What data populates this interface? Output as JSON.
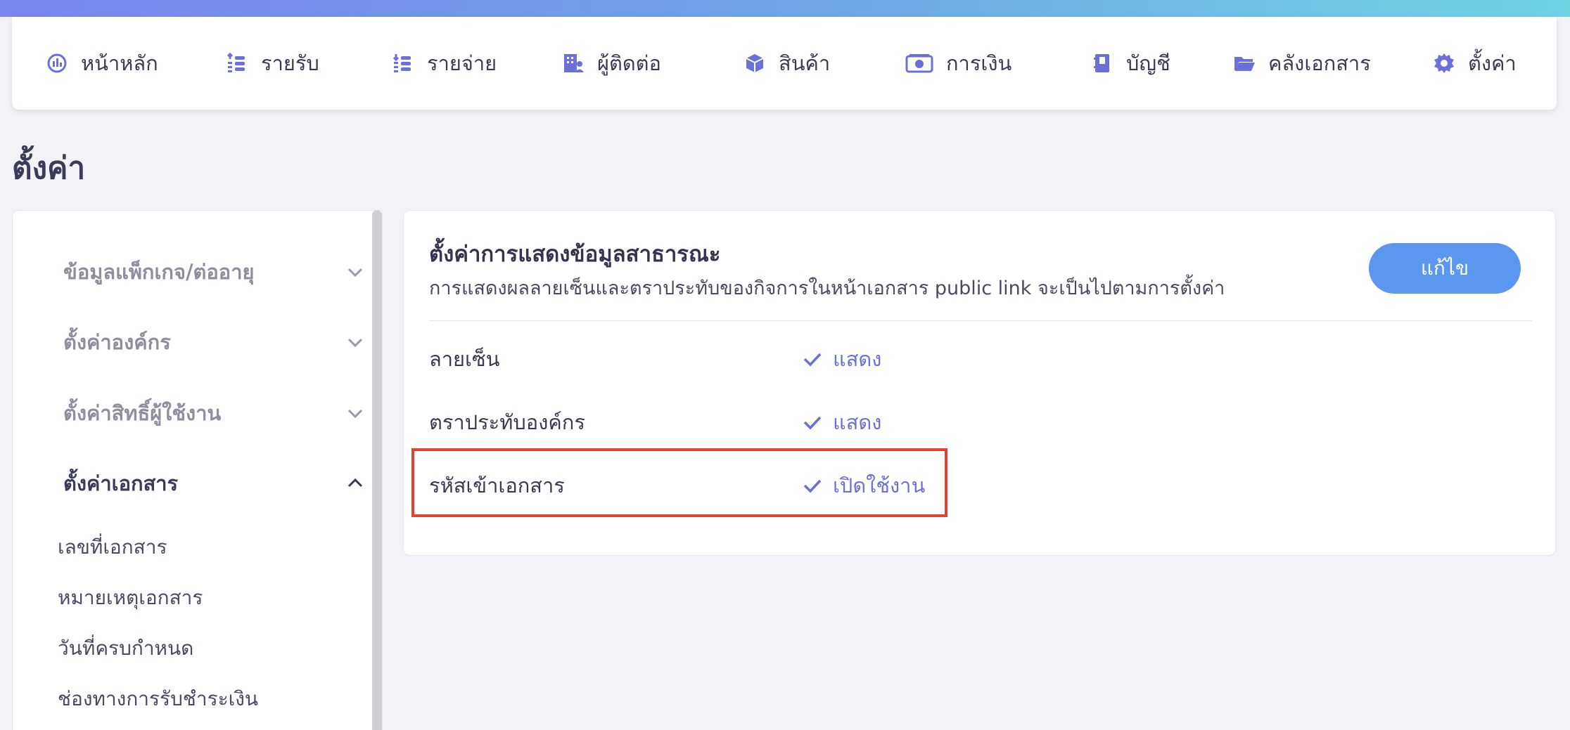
{
  "nav": {
    "items": [
      {
        "label": "หน้าหลัก",
        "icon": "dashboard-icon"
      },
      {
        "label": "รายรับ",
        "icon": "income-icon"
      },
      {
        "label": "รายจ่าย",
        "icon": "expense-icon"
      },
      {
        "label": "ผู้ติดต่อ",
        "icon": "contacts-icon"
      },
      {
        "label": "สินค้า",
        "icon": "product-box-icon"
      },
      {
        "label": "การเงิน",
        "icon": "money-icon"
      },
      {
        "label": "บัญชี",
        "icon": "accounting-book-icon"
      },
      {
        "label": "คลังเอกสาร",
        "icon": "folder-icon"
      },
      {
        "label": "ตั้งค่า",
        "icon": "gear-icon"
      }
    ],
    "icon_color": "#6b6fd8"
  },
  "page_title": "ตั้งค่า",
  "sidebar": {
    "sections": [
      {
        "label": "ข้อมูลแพ็กเกจ/ต่ออายุ",
        "expanded": false
      },
      {
        "label": "ตั้งค่าองค์กร",
        "expanded": false
      },
      {
        "label": "ตั้งค่าสิทธิ์ผู้ใช้งาน",
        "expanded": false
      },
      {
        "label": "ตั้งค่าเอกสาร",
        "expanded": true
      }
    ],
    "sub_items": [
      {
        "label": "เลขที่เอกสาร"
      },
      {
        "label": "หมายเหตุเอกสาร"
      },
      {
        "label": "วันที่ครบกำหนด"
      },
      {
        "label": "ช่องทางการรับชำระเงิน"
      }
    ]
  },
  "card": {
    "title": "ตั้งค่าการแสดงข้อมูลสาธารณะ",
    "description": "การแสดงผลลายเซ็นและตราประทับของกิจการในหน้าเอกสาร public link จะเป็นไปตามการตั้งค่า",
    "edit_label": "แก้ไข",
    "rows": [
      {
        "label": "ลายเซ็น",
        "value": "แสดง"
      },
      {
        "label": "ตราประทับองค์กร",
        "value": "แสดง"
      },
      {
        "label": "รหัสเข้าเอกสาร",
        "value": "เปิดใช้งาน"
      }
    ]
  },
  "colors": {
    "accent": "#6b6fd8",
    "button": "#5b97ef",
    "highlight_border": "#e0442f"
  }
}
